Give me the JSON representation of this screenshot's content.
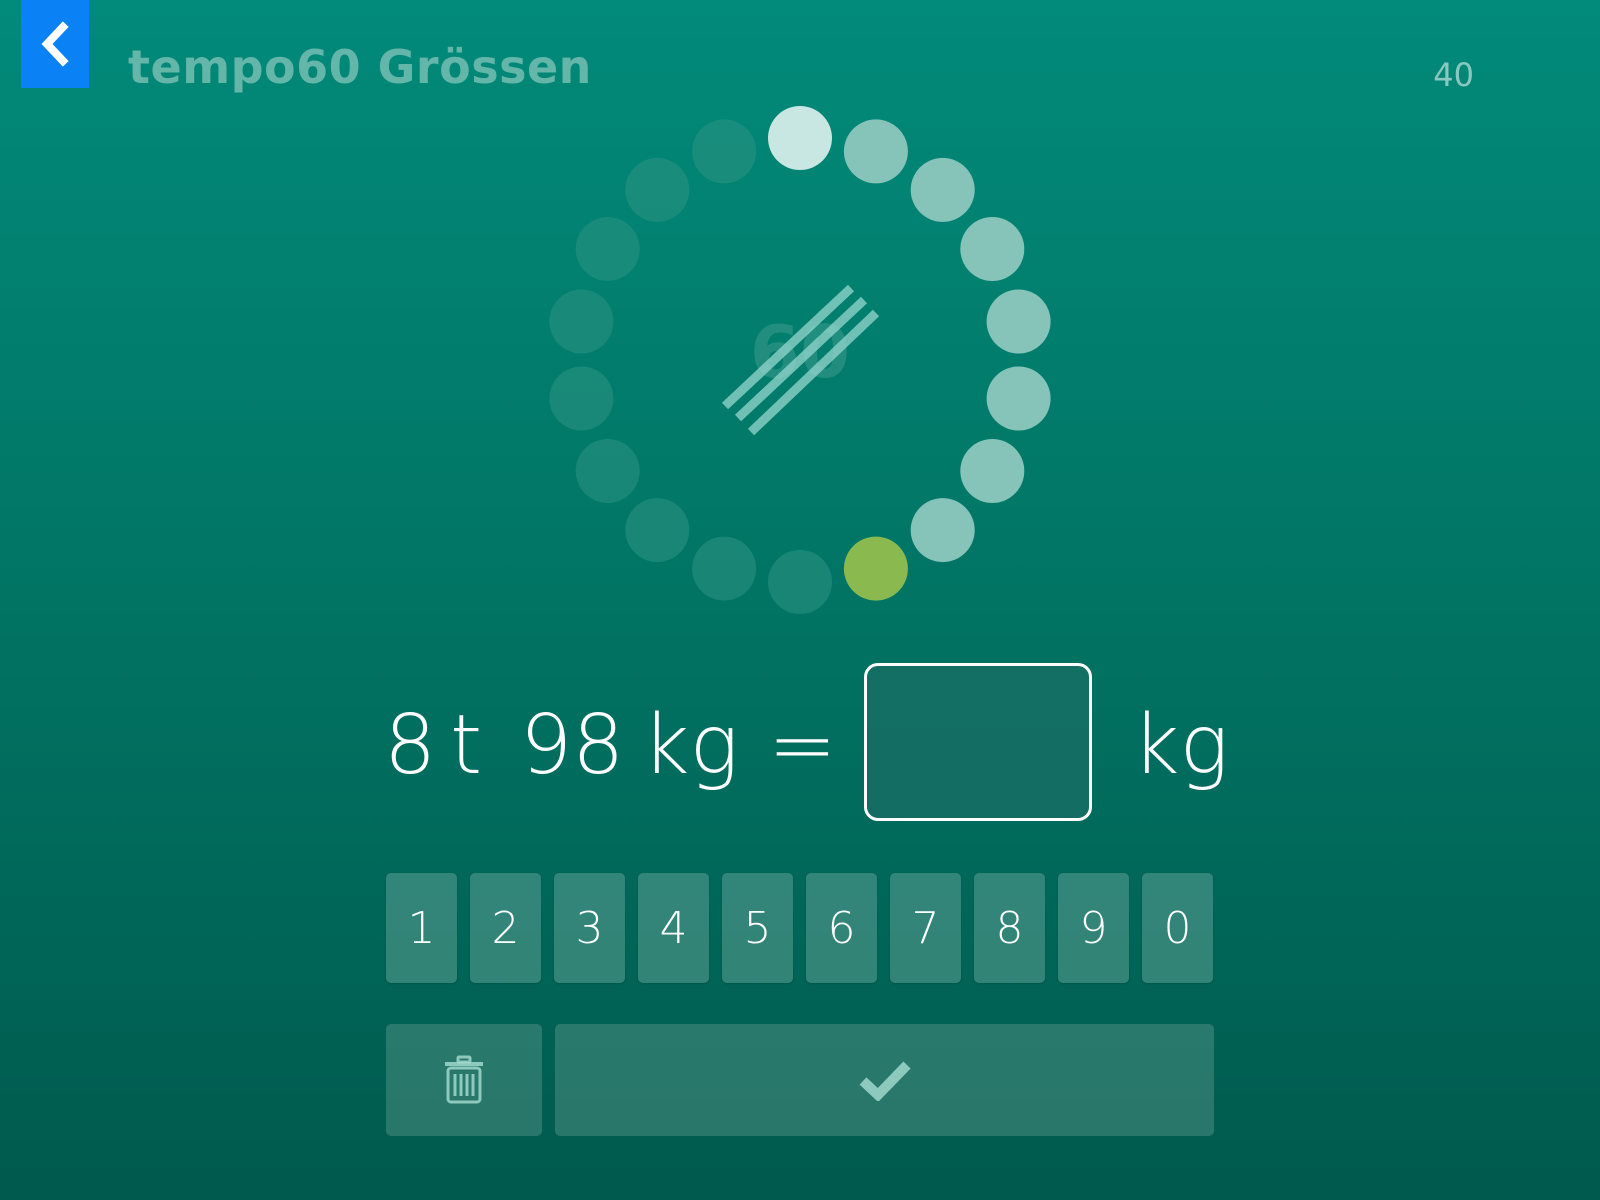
{
  "header": {
    "title": "tempo60 Grössen",
    "score": "40"
  },
  "timer": {
    "label": "60",
    "total_dots": 18,
    "highlight_dot_index": 9,
    "colors": {
      "done": "#c8e6e2",
      "pending": "#86c3b9",
      "dim": "#2d9484",
      "highlight": "#8ab94f"
    }
  },
  "equation": {
    "value1": "8",
    "unit1": "t",
    "value2": "98",
    "unit2": "kg",
    "equals": "=",
    "answer": "",
    "answer_unit": "kg"
  },
  "keypad": {
    "keys": [
      "1",
      "2",
      "3",
      "4",
      "5",
      "6",
      "7",
      "8",
      "9",
      "0"
    ]
  },
  "icons": {
    "back": "chevron-left-icon",
    "delete": "trash-icon",
    "submit": "checkmark-icon"
  },
  "colors": {
    "background_top": "#028a7a",
    "background_bottom": "#005a4d",
    "back_button": "#0a82f5"
  }
}
